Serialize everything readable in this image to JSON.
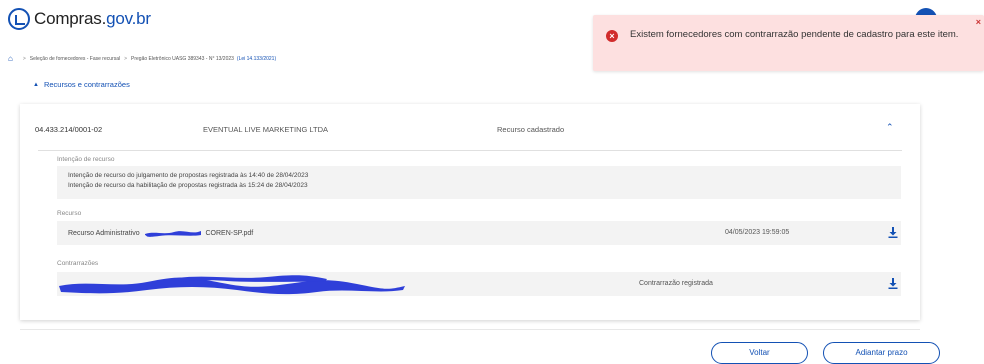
{
  "header": {
    "logo_text": "Compras.",
    "logo_gov": "gov.br"
  },
  "breadcrumb": {
    "step1": "Seleção de fornecedores - Fase recursal",
    "step2": "Pregão Eletrônico  UASG 389343 - N° 13/2023",
    "law": "(Lei 14.133/2021)"
  },
  "toast": {
    "message": "Existem fornecedores com contrarrazão pendente de cadastro para este item.",
    "type": "error",
    "color": "#d12c2c"
  },
  "section": {
    "title": "Recursos e contrarrazões"
  },
  "supplier": {
    "cnpj": "04.433.214/0001-02",
    "name": "EVENTUAL LIVE MARKETING LTDA",
    "status": "Recurso cadastrado"
  },
  "intencao": {
    "label": "Intenção de recurso",
    "line1": "Intenção de recurso do julgamento de propostas registrada às 14:40 de 28/04/2023",
    "line2": "Intenção de recurso da habilitação de propostas registrada às 15:24 de 28/04/2023"
  },
  "recurso": {
    "label": "Recurso",
    "file_name": "Recurso Administrativo",
    "file_suffix": "COREN-SP.pdf",
    "date": "04/05/2023 19:59:05"
  },
  "contrarrazoes": {
    "label": "Contrarrazões",
    "status": "Contrarrazão registrada"
  },
  "buttons": {
    "voltar": "Voltar",
    "adiantar": "Adiantar prazo"
  },
  "colors": {
    "brand": "#1351b4",
    "toast_bg": "#fde0e0",
    "redaction": "#2f3fd9"
  }
}
